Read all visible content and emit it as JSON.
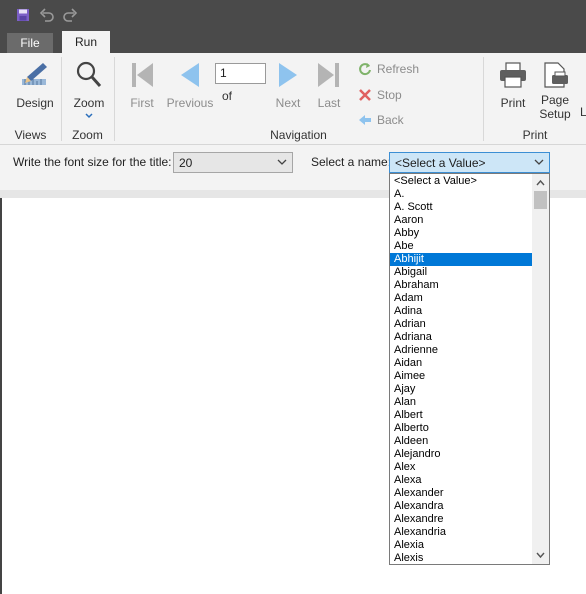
{
  "tabs": {
    "file": "File",
    "run": "Run"
  },
  "ribbon": {
    "design": "Design",
    "zoom": "Zoom",
    "first": "First",
    "previous": "Previous",
    "page_value": "1",
    "of": "of",
    "next": "Next",
    "last": "Last",
    "refresh": "Refresh",
    "stop": "Stop",
    "back": "Back",
    "print": "Print",
    "page_setup": "Page Setup",
    "cutoff": "L",
    "groups": {
      "views": "Views",
      "zoom": "Zoom",
      "navigation": "Navigation",
      "print": "Print"
    }
  },
  "params": {
    "font_size_label": "Write the font size for the title:",
    "font_size_value": "20",
    "name_label": "Select a name:",
    "name_value": "<Select a Value>"
  },
  "dropdown": {
    "selected_index": 6,
    "options": [
      "<Select a Value>",
      "A.",
      "A. Scott",
      "Aaron",
      "Abby",
      "Abe",
      "Abhijit",
      "Abigail",
      "Abraham",
      "Adam",
      "Adina",
      "Adrian",
      "Adriana",
      "Adrienne",
      "Aidan",
      "Aimee",
      "Ajay",
      "Alan",
      "Albert",
      "Alberto",
      "Aldeen",
      "Alejandro",
      "Alex",
      "Alexa",
      "Alexander",
      "Alexandra",
      "Alexandre",
      "Alexandria",
      "Alexia",
      "Alexis"
    ]
  },
  "colors": {
    "accent": "#0078d7",
    "titlebar": "#4a4a4a",
    "ribbon": "#f3f3f3",
    "nav_arrow": "#8ec3ee",
    "disabled_arrow": "#b4b4b4"
  }
}
